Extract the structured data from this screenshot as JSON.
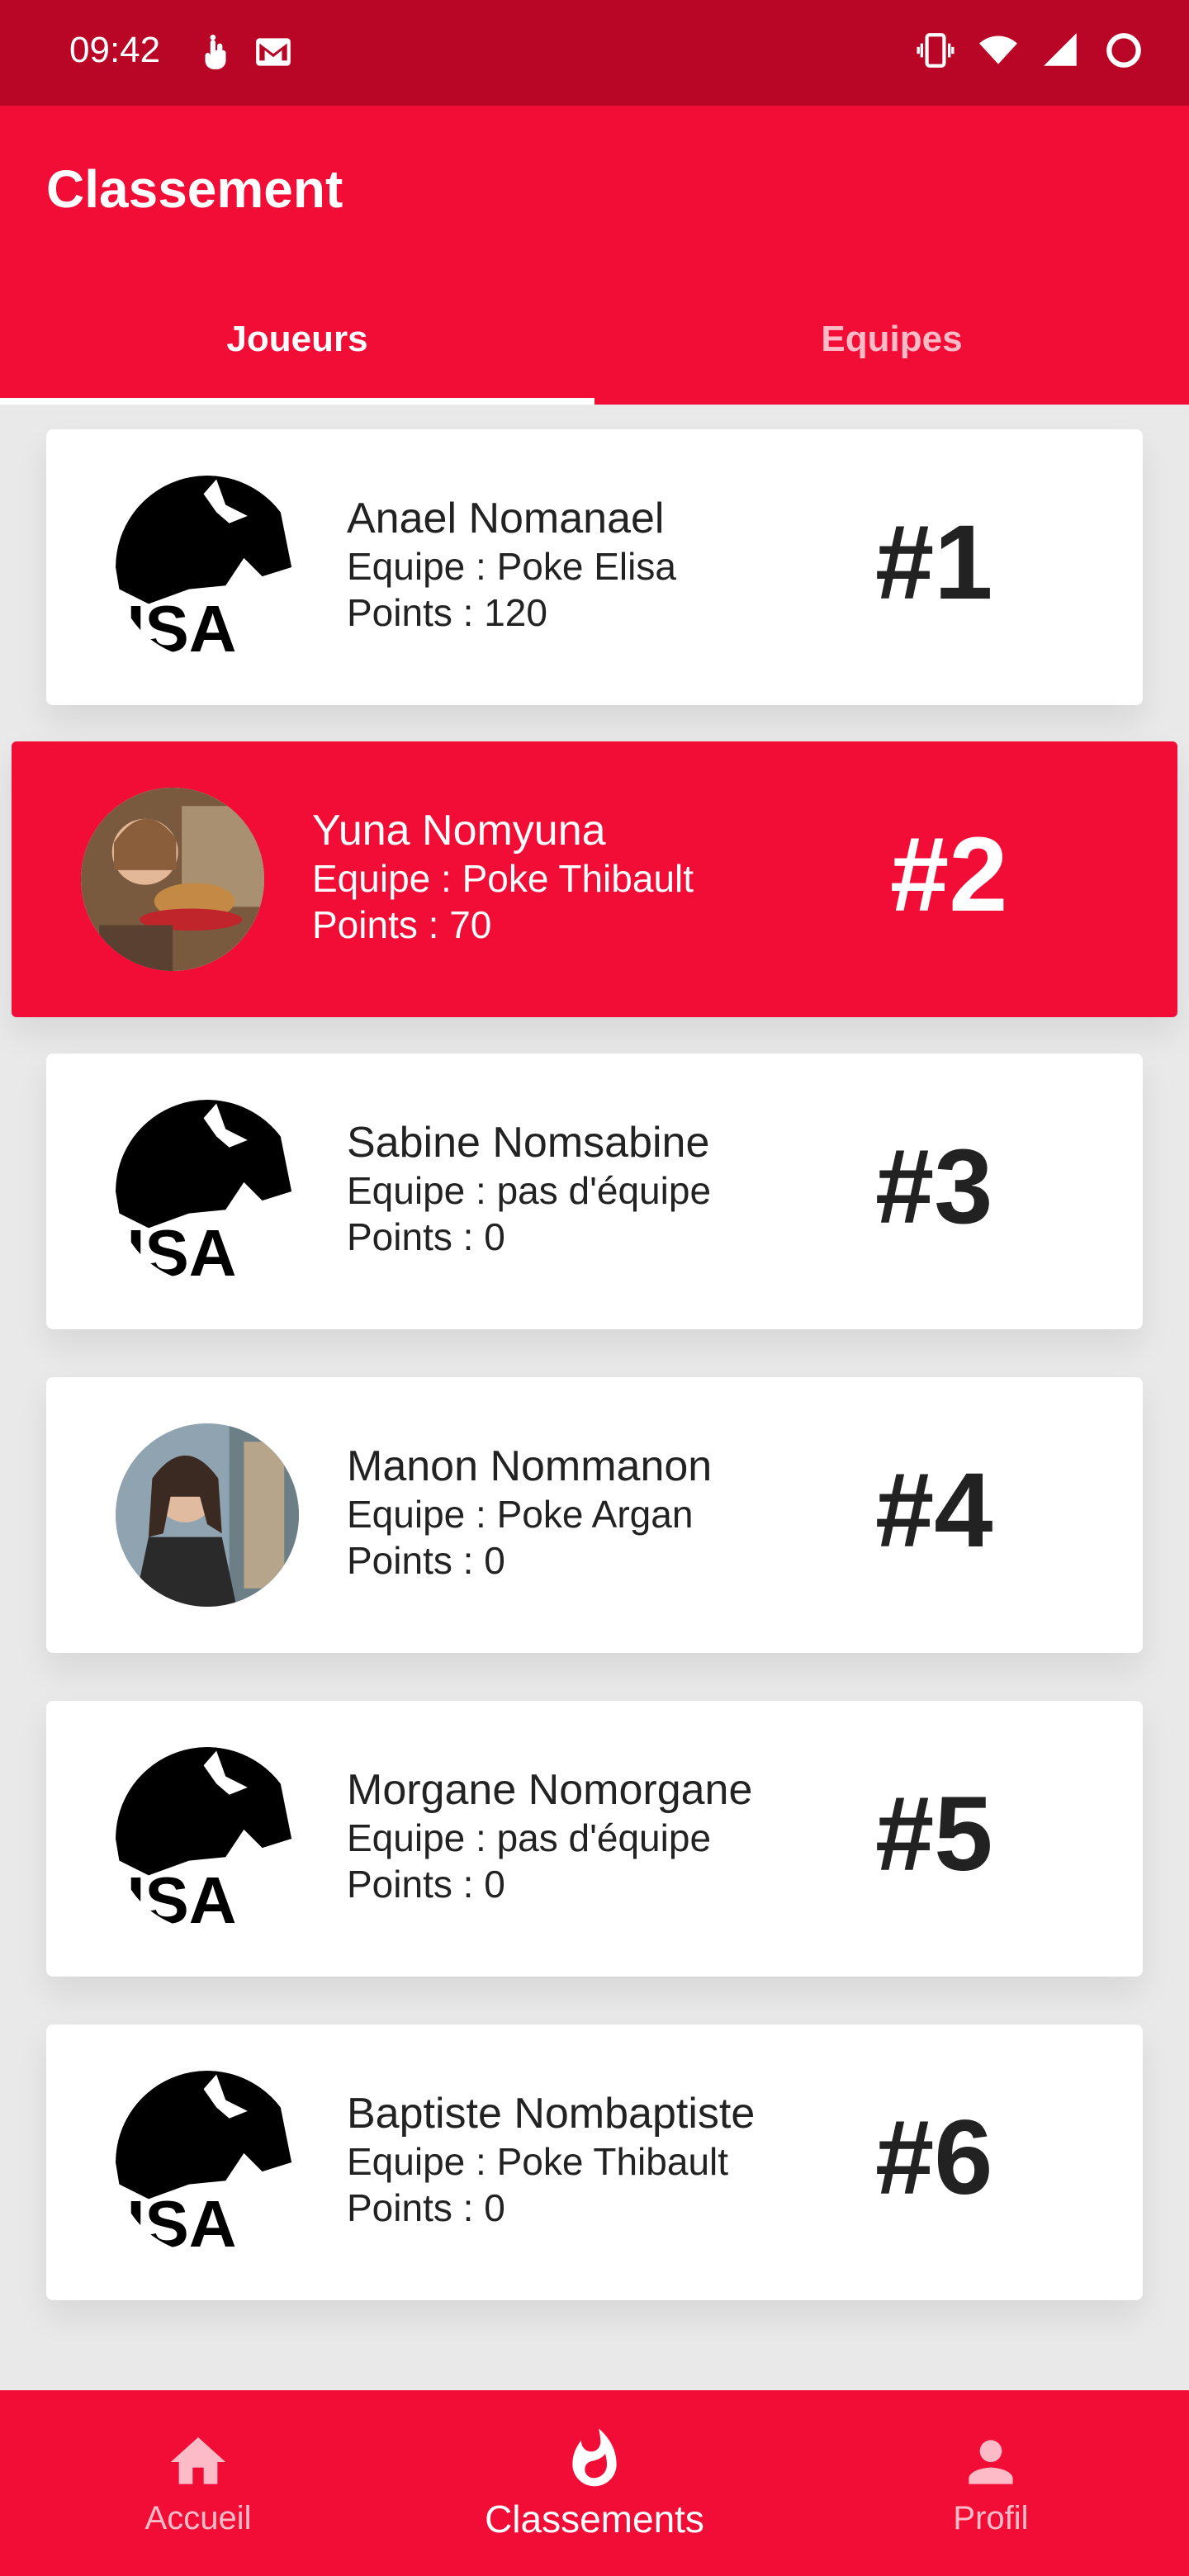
{
  "status_bar": {
    "time": "09:42",
    "left_icons": [
      "touch-icon",
      "gmail-icon"
    ],
    "right_icons": [
      "vibrate-icon",
      "wifi-icon",
      "signal-icon",
      "battery-ring-icon"
    ]
  },
  "app_bar": {
    "title": "Classement"
  },
  "tabs": [
    {
      "label": "Joueurs",
      "active": true
    },
    {
      "label": "Equipes",
      "active": false
    }
  ],
  "players": [
    {
      "name": "Anael Nomanael",
      "team": "Equipe : Poke Elisa",
      "points": "Points : 120",
      "rank": "#1",
      "avatar": "isa-wolf-logo"
    },
    {
      "name": "Yuna Nomyuna",
      "team": "Equipe : Poke Thibault",
      "points": "Points : 70",
      "rank": "#2",
      "avatar": "user-photo-burger",
      "highlighted": true
    },
    {
      "name": "Sabine Nomsabine",
      "team": "Equipe : pas d'équipe",
      "points": "Points : 0",
      "rank": "#3",
      "avatar": "isa-wolf-logo"
    },
    {
      "name": "Manon Nommanon",
      "team": "Equipe : Poke Argan",
      "points": "Points : 0",
      "rank": "#4",
      "avatar": "user-photo-woman"
    },
    {
      "name": "Morgane Nomorgane",
      "team": "Equipe : pas d'équipe",
      "points": "Points : 0",
      "rank": "#5",
      "avatar": "isa-wolf-logo"
    },
    {
      "name": "Baptiste Nombaptiste",
      "team": "Equipe : Poke Thibault",
      "points": "Points : 0",
      "rank": "#6",
      "avatar": "isa-wolf-logo"
    }
  ],
  "bottom_nav": [
    {
      "label": "Accueil",
      "icon": "home-icon",
      "active": false
    },
    {
      "label": "Classements",
      "icon": "flame-icon",
      "active": true
    },
    {
      "label": "Profil",
      "icon": "person-icon",
      "active": false
    }
  ],
  "colors": {
    "primary": "#f20d37",
    "status_bar": "#b90626",
    "background": "#e9e9e9",
    "text_dark": "#222222"
  }
}
